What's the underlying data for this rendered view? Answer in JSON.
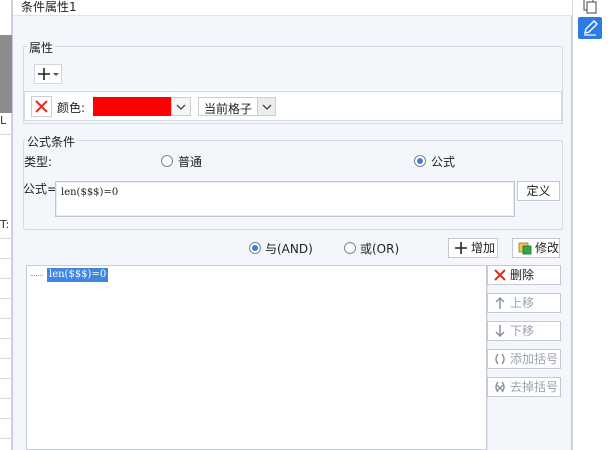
{
  "window": {
    "title": "条件属性1"
  },
  "background": {
    "glyph_l": "L",
    "glyph_t": "T:"
  },
  "attributes": {
    "legend": "属性",
    "add_icon": "plus-dropdown-icon",
    "row": {
      "color_label": "颜色:",
      "color_value": "#ff0000",
      "scope_value": "当前格子"
    }
  },
  "formula_condition": {
    "legend": "公式条件",
    "type_label": "类型:",
    "type_options": [
      {
        "label": "普通",
        "selected": false
      },
      {
        "label": "公式",
        "selected": true
      }
    ],
    "formula_label": "公式=",
    "formula_value": "len($$$)=0",
    "define_label": "定义"
  },
  "logic": {
    "and_label": "与(AND)",
    "or_label": "或(OR)",
    "and_selected": true
  },
  "buttons": {
    "add": "增加",
    "modify": "修改",
    "delete": "删除",
    "move_up": "上移",
    "move_down": "下移",
    "add_bracket": "添加括号",
    "remove_bracket": "去掉括号"
  },
  "condition_list": {
    "items": [
      {
        "text": "len($$$)=0",
        "selected": true
      }
    ]
  },
  "colors": {
    "accent": "#3f86e0",
    "danger": "#e0301e",
    "panel": "#f3f6fb"
  }
}
